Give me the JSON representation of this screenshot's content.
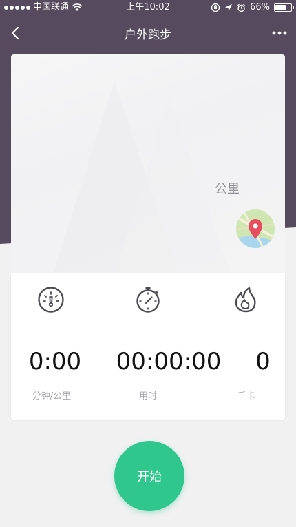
{
  "status_bar": {
    "carrier": "中国联通",
    "time": "上午10:02",
    "battery_text": "66%",
    "battery_level": 0.66
  },
  "nav": {
    "title": "户外跑步",
    "back_icon": "chevron-left-icon",
    "more_icon": "more-dots-icon"
  },
  "map": {
    "distance_unit": "公里",
    "map_icon": "map-pin-icon"
  },
  "stats": [
    {
      "icon": "speedometer-icon",
      "value": "0:00",
      "label": "分钟/公里"
    },
    {
      "icon": "stopwatch-icon",
      "value": "00:00:00",
      "label": "用时"
    },
    {
      "icon": "flame-icon",
      "value": "0",
      "label": "千卡"
    }
  ],
  "start_button": {
    "label": "开始"
  },
  "colors": {
    "header_bg": "#564a5e",
    "accent_green": "#2fc78e",
    "pin_red": "#e84c5f",
    "icon_stroke": "#4a4a52",
    "label_gray": "#a8a8ad"
  }
}
